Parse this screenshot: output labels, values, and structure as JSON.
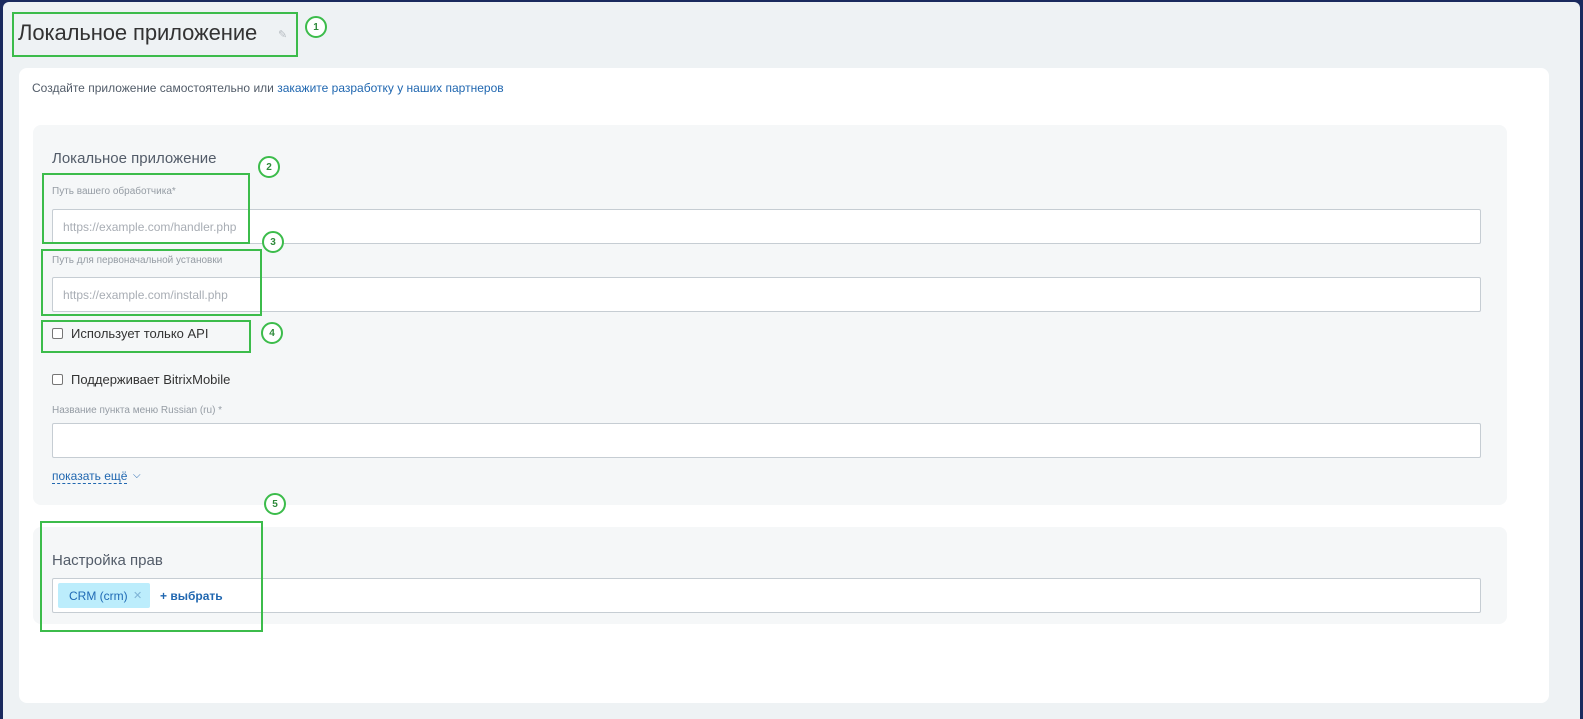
{
  "page": {
    "title": "Локальное приложение",
    "intro_text": "Создайте приложение самостоятельно или ",
    "intro_link": "закажите разработку у наших партнеров"
  },
  "local_app": {
    "section_title": "Локальное приложение",
    "handler_label": "Путь вашего обработчика*",
    "handler_placeholder": "https://example.com/handler.php",
    "install_label": "Путь для первоначальной установки",
    "install_placeholder": "https://example.com/install.php",
    "api_only_label": "Использует только API",
    "mobile_label": "Поддерживает BitrixMobile",
    "menu_name_label": "Название пункта меню Russian (ru) *",
    "menu_name_value": "",
    "show_more": "показать ещё"
  },
  "rights": {
    "section_title": "Настройка прав",
    "tags": [
      "CRM (crm)"
    ],
    "select_label": "+ выбрать"
  },
  "annotations": [
    "1",
    "2",
    "3",
    "4",
    "5"
  ],
  "colors": {
    "annotation": "#3cbc4b",
    "link": "#2067b0",
    "tag_bg": "#bcedfc"
  }
}
